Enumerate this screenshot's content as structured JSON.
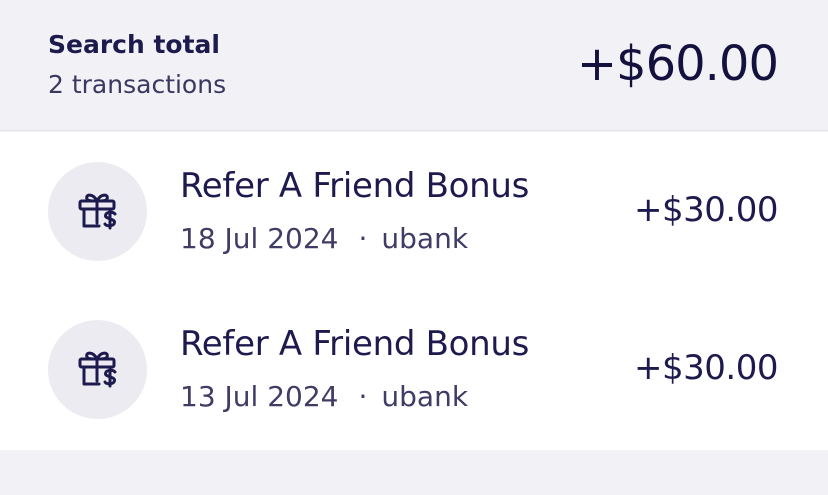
{
  "summary": {
    "title": "Search total",
    "count": "2 transactions",
    "amount": "+$60.00"
  },
  "transactions": [
    {
      "icon": "gift-dollar-icon",
      "title": "Refer A Friend Bonus",
      "date": "18 Jul 2024",
      "separator": "·",
      "source": "ubank",
      "amount": "+$30.00"
    },
    {
      "icon": "gift-dollar-icon",
      "title": "Refer A Friend Bonus",
      "date": "13 Jul 2024",
      "separator": "·",
      "source": "ubank",
      "amount": "+$30.00"
    }
  ],
  "colors": {
    "text": "#1d1a4e",
    "background": "#f2f2f6",
    "icon_bg": "#ebebf1"
  }
}
